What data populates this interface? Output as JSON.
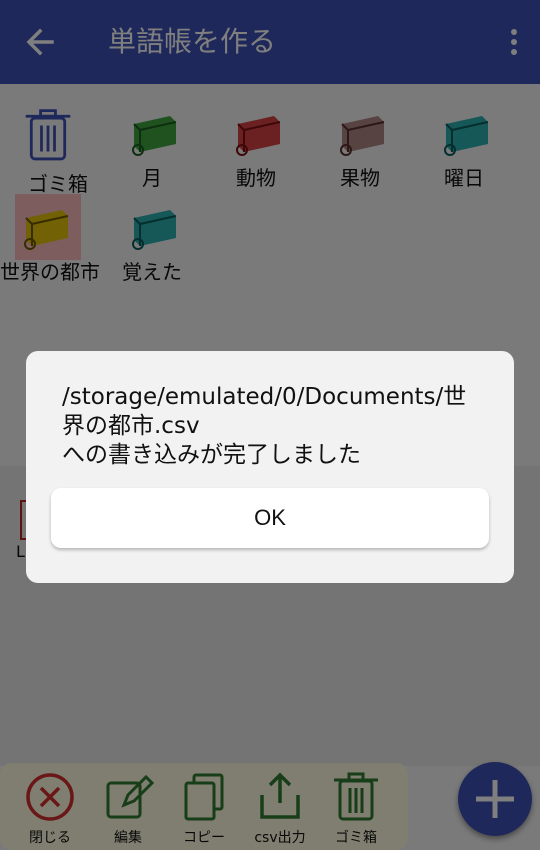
{
  "appbar": {
    "title": "単語帳を作る",
    "color": "#3f51b5"
  },
  "folders": [
    {
      "label": "ゴミ箱",
      "icon": "trash-icon",
      "color": "#3f51b5"
    },
    {
      "label": "月",
      "icon": "book-icon",
      "color": "#2e9b2e"
    },
    {
      "label": "動物",
      "icon": "book-icon",
      "color": "#d32f2f"
    },
    {
      "label": "果物",
      "icon": "book-icon",
      "color": "#8d5b5b"
    },
    {
      "label": "曜日",
      "icon": "book-icon",
      "color": "#16a6a6"
    },
    {
      "label": "世界の都市",
      "icon": "book-icon",
      "color": "#d4b800",
      "selected": true
    },
    {
      "label": "覚えた",
      "icon": "book-icon",
      "color": "#16a6a6"
    }
  ],
  "lower_list": {
    "item_label": "L"
  },
  "bottom_toolbar": {
    "buttons": [
      {
        "label": "閉じる",
        "icon": "close-circle-icon",
        "color": "#d32f2f"
      },
      {
        "label": "編集",
        "icon": "edit-icon",
        "color": "#2e7d32"
      },
      {
        "label": "コピー",
        "icon": "copy-icon",
        "color": "#2e7d32"
      },
      {
        "label": "csv出力",
        "icon": "share-icon",
        "color": "#2e7d32"
      },
      {
        "label": "ゴミ箱",
        "icon": "trash-icon",
        "color": "#2e7d32"
      }
    ]
  },
  "fab": {
    "icon": "plus-icon",
    "color": "#3f51b5"
  },
  "dialog": {
    "message": "/storage/emulated/0/Documents/世界の都市.csv\nへの書き込みが完了しました",
    "ok_label": "OK"
  }
}
